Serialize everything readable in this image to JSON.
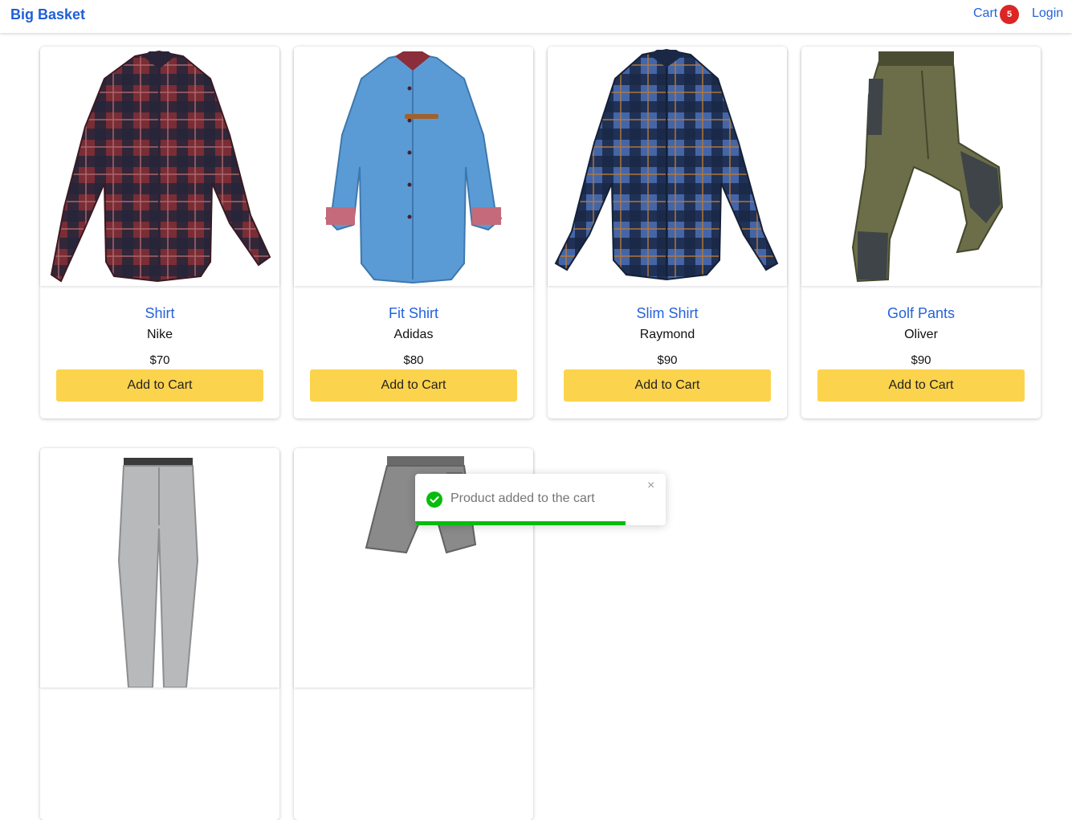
{
  "navbar": {
    "brand": "Big Basket",
    "cart_label": "Cart",
    "cart_count": "5",
    "login_label": "Login"
  },
  "products": [
    {
      "name": "Shirt",
      "brand": "Nike",
      "price": "$70",
      "button": "Add to Cart",
      "image_icon": "plaid-red-shirt-icon"
    },
    {
      "name": "Fit Shirt",
      "brand": "Adidas",
      "price": "$80",
      "button": "Add to Cart",
      "image_icon": "denim-shirt-icon"
    },
    {
      "name": "Slim Shirt",
      "brand": "Raymond",
      "price": "$90",
      "button": "Add to Cart",
      "image_icon": "plaid-blue-shirt-icon"
    },
    {
      "name": "Golf Pants",
      "brand": "Oliver",
      "price": "$90",
      "button": "Add to Cart",
      "image_icon": "cargo-pants-icon"
    }
  ],
  "partial_products": [
    {
      "image_icon": "grey-trousers-icon"
    },
    {
      "image_icon": "grey-shorts-icon"
    }
  ],
  "toast": {
    "message": "Product added to the cart",
    "close": "×",
    "progress_fraction": 0.84
  },
  "colors": {
    "brand": "#1f5fd6",
    "link": "#2563d9",
    "badge": "#dc2626",
    "button": "#fcd34d",
    "toast_progress": "#07bc0c"
  }
}
